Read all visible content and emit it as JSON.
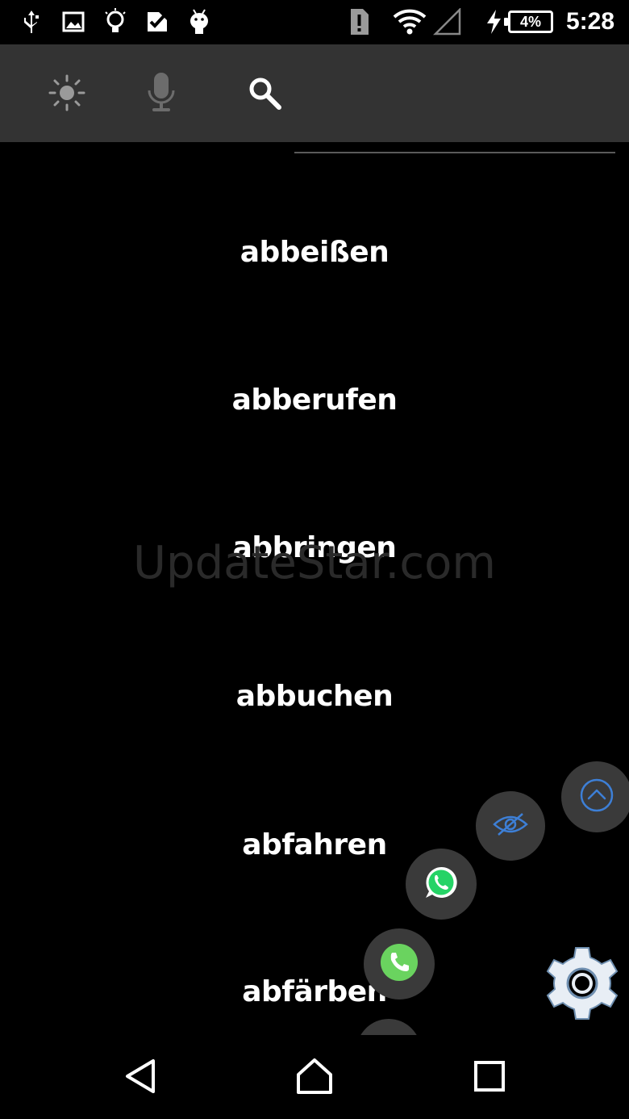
{
  "status_bar": {
    "battery_text": "4%",
    "time": "5:28",
    "icons": [
      "usb-icon",
      "image-icon",
      "bulb-icon",
      "check-icon",
      "android-icon",
      "alert-icon",
      "wifi-icon",
      "signal-icon",
      "charging-icon",
      "battery-icon"
    ]
  },
  "toolbar": {
    "icons": [
      "brightness-icon",
      "microphone-icon",
      "search-icon"
    ],
    "search_value": ""
  },
  "words": [
    "abbeißen",
    "abberufen",
    "abbringen",
    "abbuchen",
    "abfahren",
    "abfärben"
  ],
  "watermark": "UpdateStar.com",
  "fabs": [
    "scroll-up-icon",
    "hide-icon",
    "whatsapp-icon",
    "phone-icon",
    "gear-icon"
  ],
  "nav": [
    "back-icon",
    "home-icon",
    "recents-icon"
  ],
  "colors": {
    "toolbar_bg": "#333333",
    "fab_bg": "#3a3a3a",
    "accent_blue": "#3d7fd6",
    "whatsapp_green": "#25d366",
    "phone_green": "#6ad35f"
  }
}
